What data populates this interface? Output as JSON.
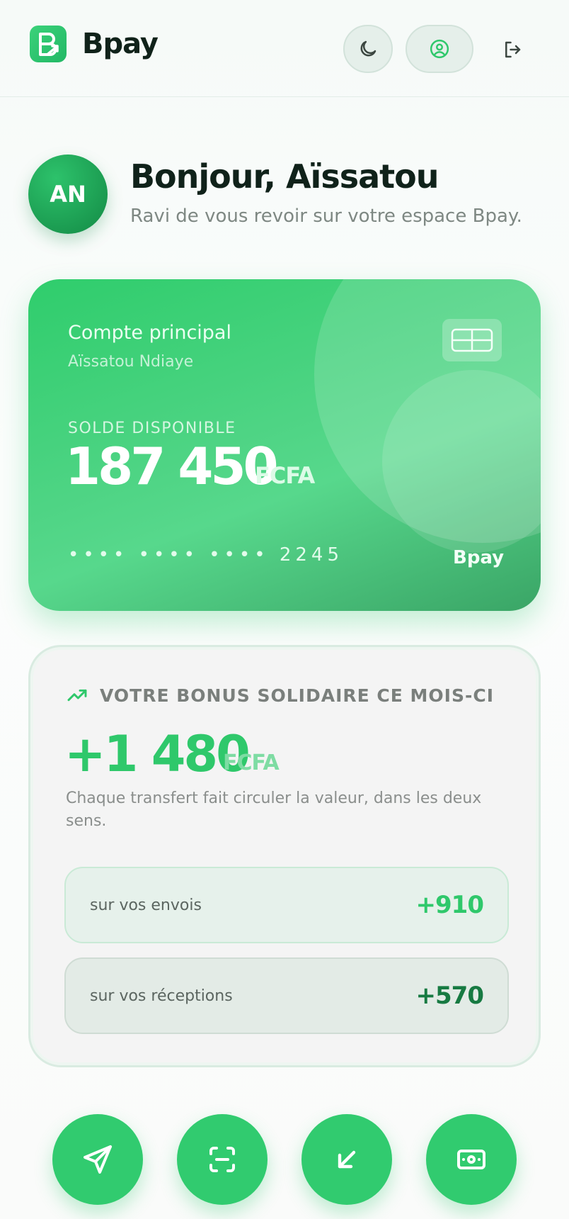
{
  "header": {
    "brand": "Bpay",
    "icons": {
      "logo": "bpay-logo-icon",
      "theme": "moon-icon",
      "profile": "user-circle-icon",
      "logout": "logout-icon"
    }
  },
  "greeting": {
    "initials": "AN",
    "title": "Bonjour, Aïssatou",
    "subtitle": "Ravi de vous revoir sur votre espace Bpay."
  },
  "card": {
    "account_name": "Compte principal",
    "holder": "Aïssatou Ndiaye",
    "balance_label": "SOLDE DISPONIBLE",
    "balance": "187 450",
    "currency": "FCFA",
    "number": "•••• •••• •••• 2245",
    "brand": "Bpay",
    "icons": {
      "chip": "card-chip-icon"
    }
  },
  "bonus": {
    "title": "VOTRE BONUS SOLIDAIRE CE MOIS-CI",
    "amount": "+1 480",
    "currency": "FCFA",
    "description": "Chaque transfert fait circuler la valeur, dans les deux sens.",
    "rows": [
      {
        "label": "sur vos envois",
        "value": "+910"
      },
      {
        "label": "sur vos réceptions",
        "value": "+570"
      }
    ],
    "icons": {
      "trend": "trending-up-icon"
    }
  },
  "actions": {
    "icons": [
      "send-icon",
      "scan-icon",
      "receive-icon",
      "cash-icon"
    ]
  },
  "colors": {
    "accent": "#31cb6f",
    "accent_dark": "#177a42",
    "text": "#10221a",
    "muted": "#7e8883"
  }
}
